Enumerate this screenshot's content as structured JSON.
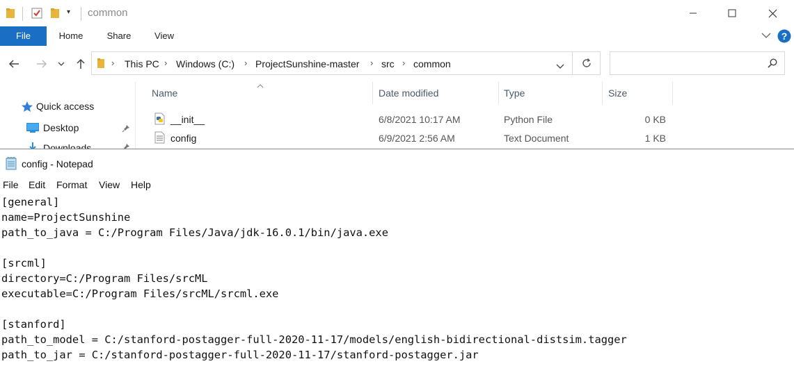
{
  "explorer": {
    "window_title": "common",
    "ribbon_tabs": [
      "File",
      "Home",
      "Share",
      "View"
    ],
    "address": {
      "crumbs": [
        "This PC",
        "Windows (C:)",
        "ProjectSunshine-master",
        "src",
        "common"
      ],
      "search_placeholder": ""
    },
    "nav_pane": {
      "items": [
        {
          "label": "Quick access"
        },
        {
          "label": "Desktop"
        },
        {
          "label": "Downloads"
        }
      ]
    },
    "columns": [
      "Name",
      "Date modified",
      "Type",
      "Size"
    ],
    "files": [
      {
        "name": "__init__",
        "date": "6/8/2021 10:17 AM",
        "type": "Python File",
        "size": "0 KB"
      },
      {
        "name": "config",
        "date": "6/9/2021 2:56 AM",
        "type": "Text Document",
        "size": "1 KB"
      }
    ],
    "colors": {
      "file_tab": "#1a6fc4",
      "folder": "#e8b43c",
      "help": "#1a6fc4"
    }
  },
  "notepad": {
    "title": "config - Notepad",
    "menu": [
      "File",
      "Edit",
      "Format",
      "View",
      "Help"
    ],
    "lines": [
      "[general]",
      "name=ProjectSunshine",
      "path_to_java = C:/Program Files/Java/jdk-16.0.1/bin/java.exe",
      "",
      "[srcml]",
      "directory=C:/Program Files/srcML",
      "executable=C:/Program Files/srcML/srcml.exe",
      "",
      "[stanford]",
      "path_to_model = C:/stanford-postagger-full-2020-11-17/models/english-bidirectional-distsim.tagger",
      "path_to_jar = C:/stanford-postagger-full-2020-11-17/stanford-postagger.jar"
    ]
  }
}
